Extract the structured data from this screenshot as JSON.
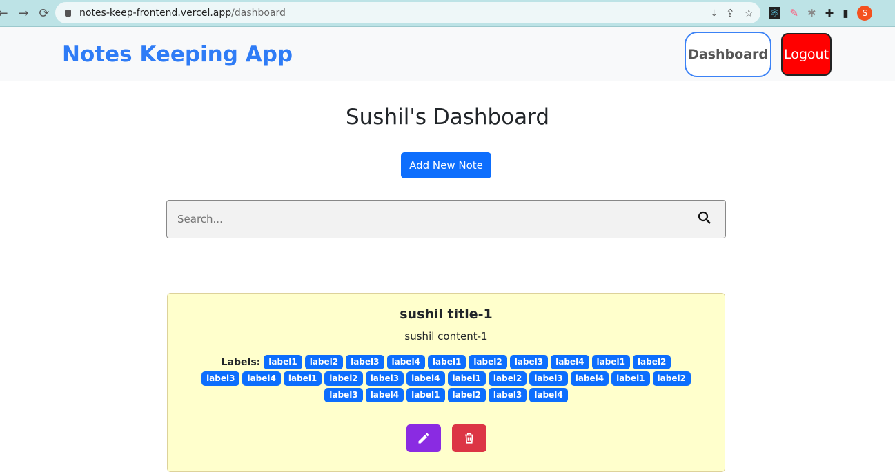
{
  "browser": {
    "url_host": "notes-keep-frontend.vercel.app",
    "url_path": "/dashboard",
    "profile_initial": "S"
  },
  "header": {
    "brand": "Notes Keeping App",
    "dashboard_label": "Dashboard",
    "logout_label": "Logout"
  },
  "main": {
    "title": "Sushil's Dashboard",
    "add_note_label": "Add New Note",
    "search_placeholder": "Search..."
  },
  "notes": [
    {
      "title": "sushil title-1",
      "content": "sushil content-1",
      "labels_heading": "Labels:",
      "labels": [
        "label1",
        "label2",
        "label3",
        "label4",
        "label1",
        "label2",
        "label3",
        "label4",
        "label1",
        "label2",
        "label3",
        "label4",
        "label1",
        "label2",
        "label3",
        "label4",
        "label1",
        "label2",
        "label3",
        "label4",
        "label1",
        "label2",
        "label3",
        "label4",
        "label1",
        "label2",
        "label3",
        "label4"
      ]
    }
  ],
  "colors": {
    "brand": "#2f7cf6",
    "primary": "#0d6efd",
    "logout": "#ff0000",
    "edit": "#8a2be2",
    "delete": "#dc3545",
    "card": "#ffffcc"
  }
}
